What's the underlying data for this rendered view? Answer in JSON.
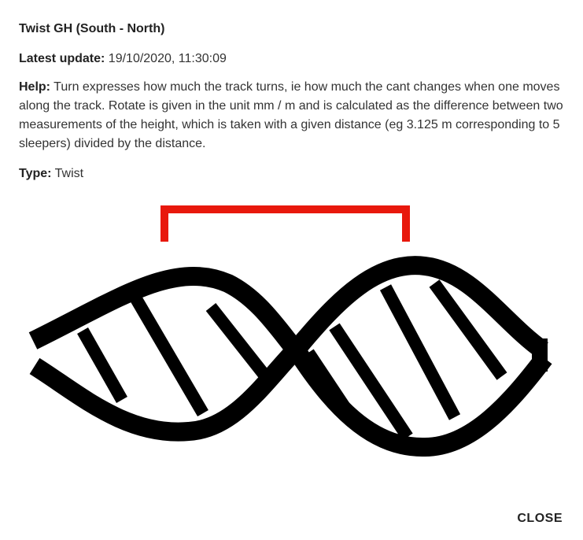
{
  "dialog": {
    "title": "Twist GH (South - North)",
    "latest_update_label": "Latest update:",
    "latest_update_value": "19/10/2020, 11:30:09",
    "help_label": "Help:",
    "help_text": "Turn expresses how much the track turns, ie how much the cant changes when one moves along the track. Rotate is given in the unit mm / m and is calculated as the difference between two measurements of the height, which is taken with a given distance (eg 3.125 m corresponding to 5 sleepers) divided by the distance.",
    "type_label": "Type:",
    "type_value": "Twist",
    "close_label": "CLOSE"
  },
  "illustration": {
    "icon": "track-twist-illustration",
    "rail_color": "#000000",
    "bracket_color": "#e8180c"
  }
}
